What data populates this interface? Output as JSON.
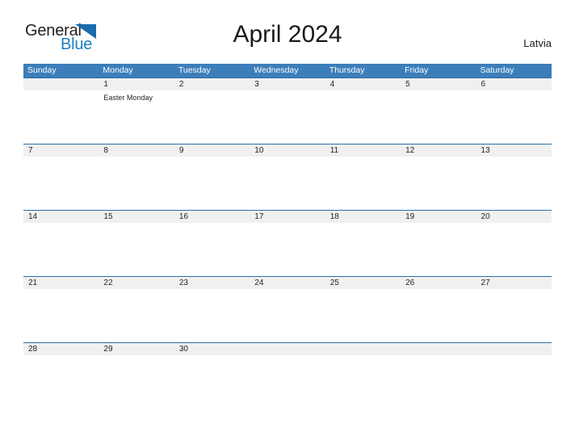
{
  "brand": {
    "name_primary": "General",
    "name_secondary": "Blue",
    "accent_color": "#1c7fc4"
  },
  "header": {
    "title": "April 2024",
    "region": "Latvia"
  },
  "calendar": {
    "header_bg_color": "#3c7eba",
    "date_band_color": "#f0f0f0",
    "rule_color": "#2e6da4",
    "weekdays": [
      "Sunday",
      "Monday",
      "Tuesday",
      "Wednesday",
      "Thursday",
      "Friday",
      "Saturday"
    ],
    "weeks": [
      {
        "days": [
          {
            "date": "",
            "events": []
          },
          {
            "date": "1",
            "events": [
              "Easter Monday"
            ]
          },
          {
            "date": "2",
            "events": []
          },
          {
            "date": "3",
            "events": []
          },
          {
            "date": "4",
            "events": []
          },
          {
            "date": "5",
            "events": []
          },
          {
            "date": "6",
            "events": []
          }
        ]
      },
      {
        "days": [
          {
            "date": "7",
            "events": []
          },
          {
            "date": "8",
            "events": []
          },
          {
            "date": "9",
            "events": []
          },
          {
            "date": "10",
            "events": []
          },
          {
            "date": "11",
            "events": []
          },
          {
            "date": "12",
            "events": []
          },
          {
            "date": "13",
            "events": []
          }
        ]
      },
      {
        "days": [
          {
            "date": "14",
            "events": []
          },
          {
            "date": "15",
            "events": []
          },
          {
            "date": "16",
            "events": []
          },
          {
            "date": "17",
            "events": []
          },
          {
            "date": "18",
            "events": []
          },
          {
            "date": "19",
            "events": []
          },
          {
            "date": "20",
            "events": []
          }
        ]
      },
      {
        "days": [
          {
            "date": "21",
            "events": []
          },
          {
            "date": "22",
            "events": []
          },
          {
            "date": "23",
            "events": []
          },
          {
            "date": "24",
            "events": []
          },
          {
            "date": "25",
            "events": []
          },
          {
            "date": "26",
            "events": []
          },
          {
            "date": "27",
            "events": []
          }
        ]
      },
      {
        "days": [
          {
            "date": "28",
            "events": []
          },
          {
            "date": "29",
            "events": []
          },
          {
            "date": "30",
            "events": []
          },
          {
            "date": "",
            "events": []
          },
          {
            "date": "",
            "events": []
          },
          {
            "date": "",
            "events": []
          },
          {
            "date": "",
            "events": []
          }
        ]
      }
    ]
  }
}
